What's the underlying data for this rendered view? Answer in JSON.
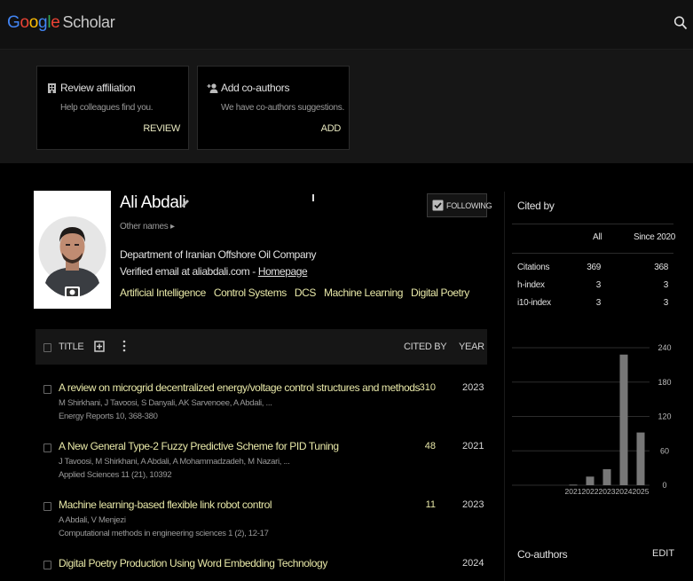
{
  "header": {
    "logo_letters": [
      "G",
      "o",
      "o",
      "g",
      "l",
      "e"
    ],
    "logo_suffix": "Scholar",
    "search_icon": "search-icon"
  },
  "banner": {
    "cards": [
      {
        "title": "Review affiliation",
        "subtitle": "Help colleagues find you.",
        "action": "REVIEW",
        "icon": "building-icon"
      },
      {
        "title": "Add co-authors",
        "subtitle": "We have co-authors suggestions.",
        "action": "ADD",
        "icon": "person-add-icon"
      }
    ]
  },
  "profile": {
    "name": "Ali Abdali",
    "other_names": "Other names ▸",
    "affiliation": "Department of Iranian Offshore Oil Company",
    "verified_prefix": "Verified email at aliabdali.com - ",
    "homepage_label": "Homepage",
    "interests": [
      "Artificial Intelligence",
      "Control Systems",
      "DCS",
      "Machine Learning",
      "Digital Poetry"
    ],
    "follow_label": "FOLLOWING"
  },
  "table": {
    "headers": {
      "title": "TITLE",
      "cited_by": "CITED BY",
      "year": "YEAR"
    },
    "rows": [
      {
        "title": "A review on microgrid decentralized energy/voltage control structures and methods",
        "authors": "M Shirkhani, J Tavoosi, S Danyali, AK Sarvenoee, A Abdali, ...",
        "venue": "Energy Reports 10, 368-380",
        "cited_by": "310",
        "year": "2023"
      },
      {
        "title": "A New General Type-2 Fuzzy Predictive Scheme for PID Tuning",
        "authors": "J Tavoosi, M Shirkhani, A Abdali, A Mohammadzadeh, M Nazari, ...",
        "venue": "Applied Sciences 11 (21), 10392",
        "cited_by": "48",
        "year": "2021"
      },
      {
        "title": "Machine learning-based flexible link robot control",
        "authors": "A Abdali, V Menjezi",
        "venue": "Computational methods in engineering sciences 1 (2), 12-17",
        "cited_by": "11",
        "year": "2023"
      },
      {
        "title": "Digital Poetry Production Using Word Embedding Technology",
        "authors": "",
        "venue": "",
        "cited_by": "",
        "year": "2024"
      }
    ]
  },
  "cited_by": {
    "title": "Cited by",
    "col_all": "All",
    "col_since": "Since 2020",
    "stats": [
      {
        "label": "Citations",
        "all": "369",
        "since": "368"
      },
      {
        "label": "h-index",
        "all": "3",
        "since": "3"
      },
      {
        "label": "i10-index",
        "all": "3",
        "since": "3"
      }
    ]
  },
  "chart_data": {
    "type": "bar",
    "categories": [
      "2021",
      "2022",
      "2023",
      "2024",
      "2025"
    ],
    "values": [
      1,
      15,
      28,
      228,
      92
    ],
    "ylim": [
      0,
      240
    ],
    "yticks": [
      "240",
      "180",
      "120",
      "60",
      "0"
    ],
    "bar_color": "#777777",
    "grid": true
  },
  "coauthors": {
    "title": "Co-authors",
    "edit_label": "EDIT"
  }
}
